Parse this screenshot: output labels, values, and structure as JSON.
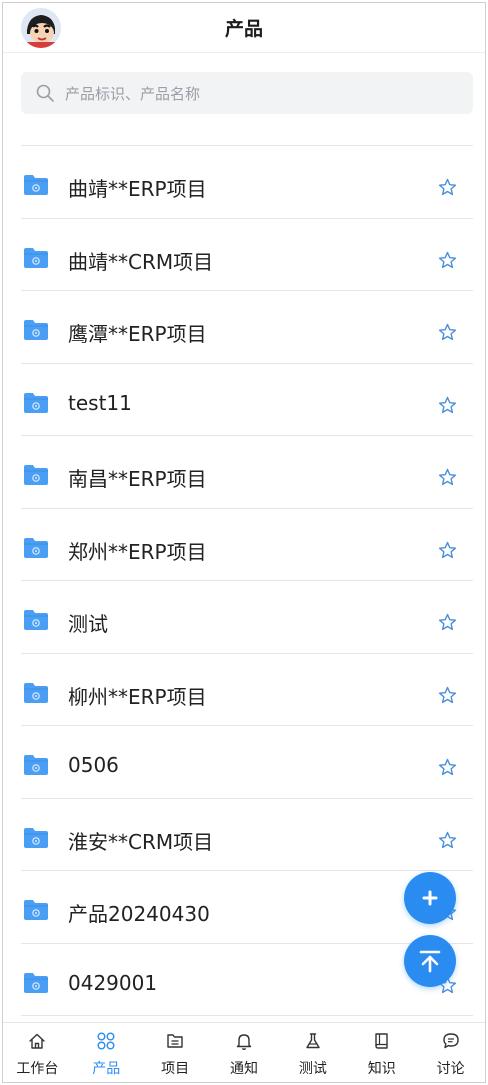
{
  "header": {
    "title": "产品"
  },
  "search": {
    "placeholder": "产品标识、产品名称"
  },
  "products": [
    {
      "name": "曲靖**ERP项目"
    },
    {
      "name": "曲靖**CRM项目"
    },
    {
      "name": "鹰潭**ERP项目"
    },
    {
      "name": "test11"
    },
    {
      "name": "南昌**ERP项目"
    },
    {
      "name": "郑州**ERP项目"
    },
    {
      "name": "测试"
    },
    {
      "name": "柳州**ERP项目"
    },
    {
      "name": "0506"
    },
    {
      "name": "淮安**CRM项目"
    },
    {
      "name": "产品20240430"
    },
    {
      "name": "0429001"
    }
  ],
  "tabbar": {
    "items": [
      {
        "label": "工作台",
        "icon": "home-icon"
      },
      {
        "label": "产品",
        "icon": "product-grid-icon",
        "active": true
      },
      {
        "label": "项目",
        "icon": "project-folder-icon"
      },
      {
        "label": "通知",
        "icon": "bell-icon"
      },
      {
        "label": "测试",
        "icon": "flask-icon"
      },
      {
        "label": "知识",
        "icon": "book-icon"
      },
      {
        "label": "讨论",
        "icon": "chat-icon"
      }
    ]
  },
  "colors": {
    "accent": "#2a8cf0",
    "folder": "#4a9ff5",
    "star": "#4a8fd8"
  }
}
